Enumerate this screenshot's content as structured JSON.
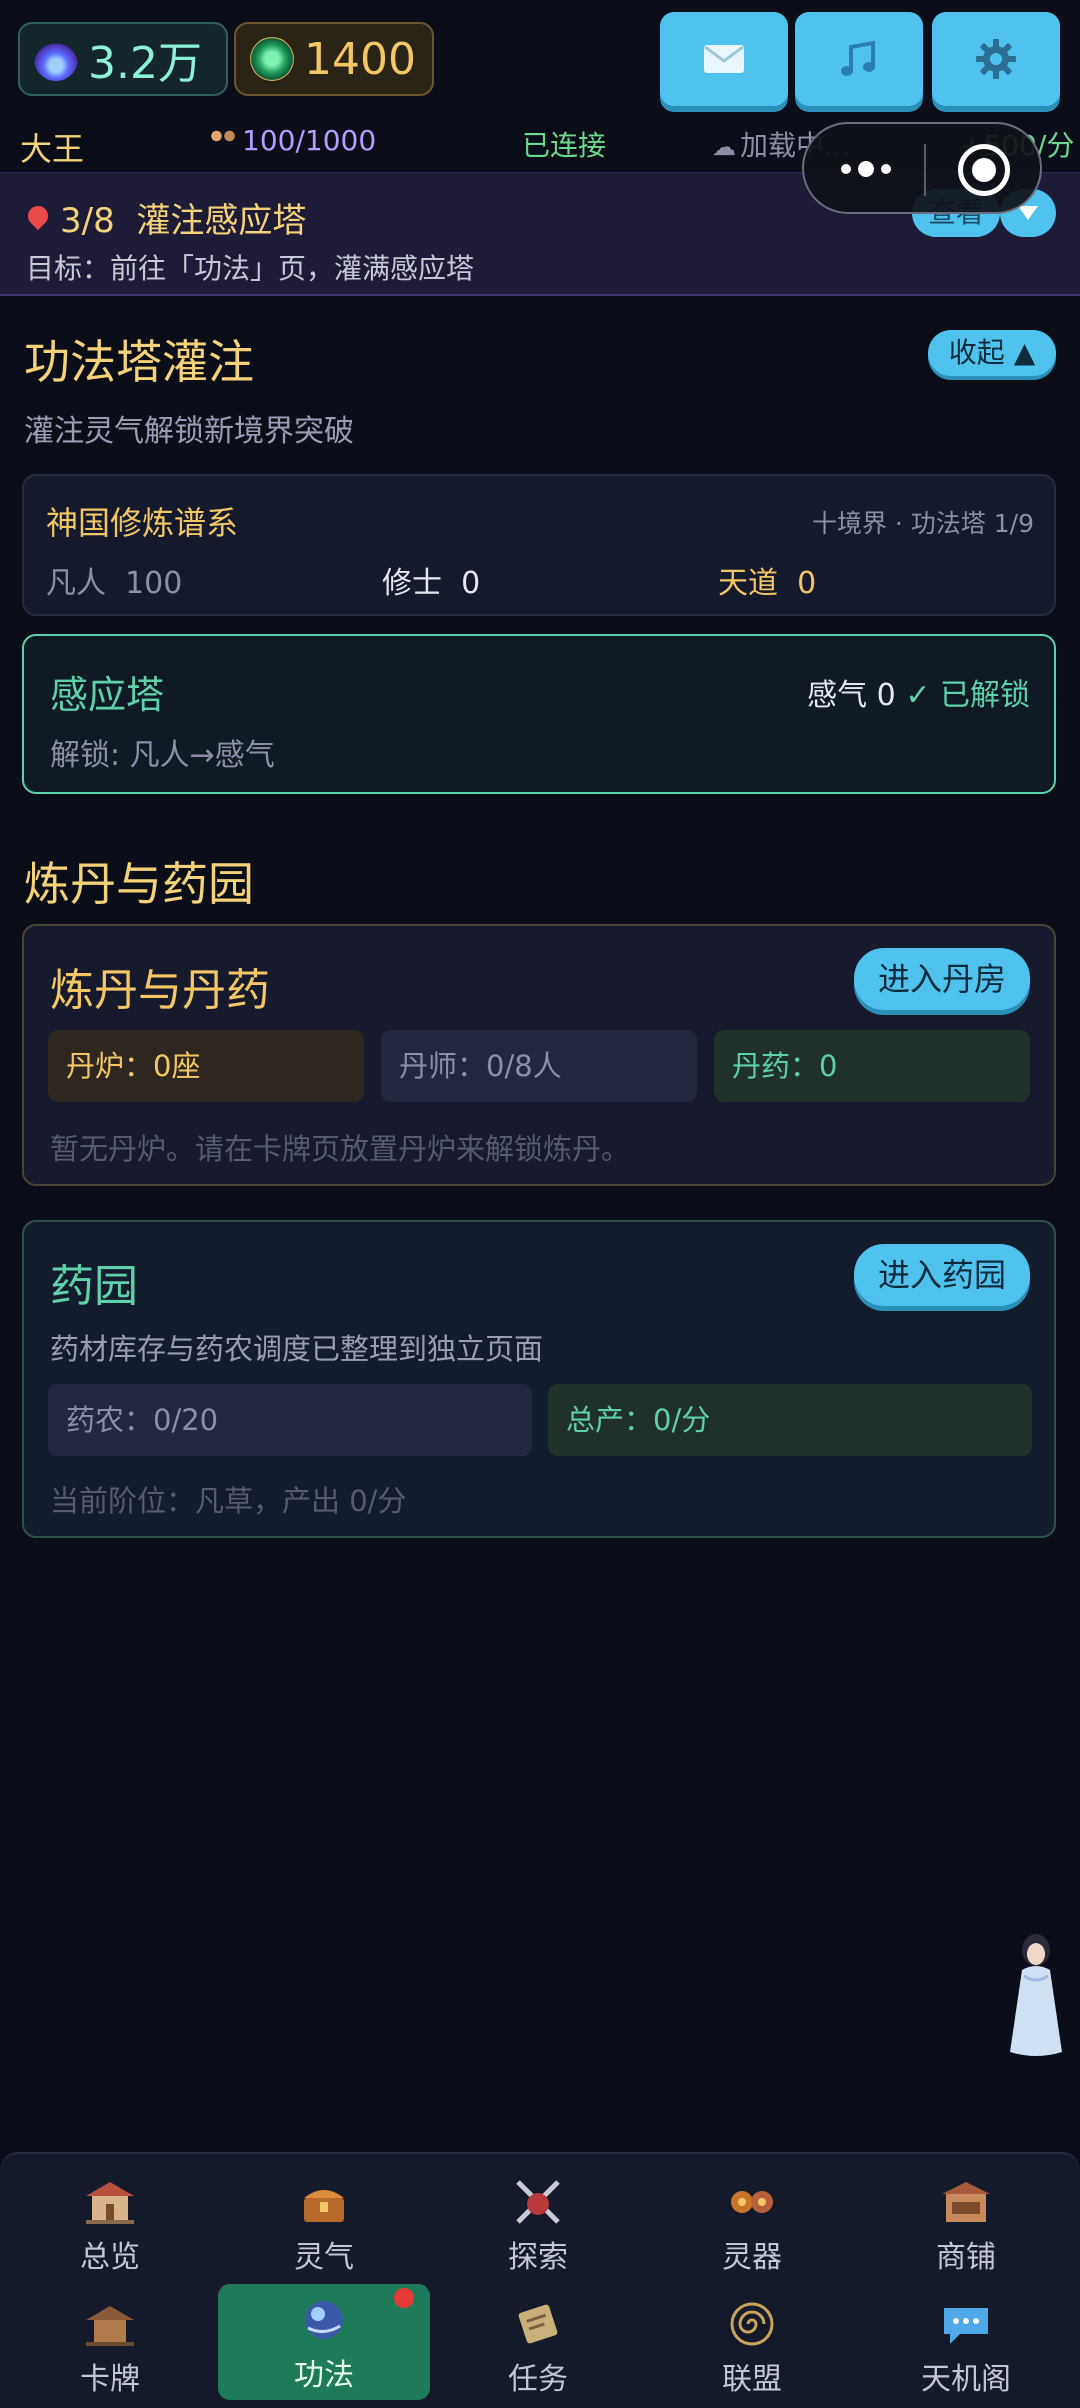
{
  "resources": {
    "spirit_value": "3.2万",
    "jade_value": "1400"
  },
  "status": {
    "player_name": "大王",
    "population": "100/1000",
    "connection": "已连接",
    "loading": "加载中...",
    "rate": "+500/分"
  },
  "quest": {
    "progress": "3/8",
    "title": "灌注感应塔",
    "goal": "目标：前往「功法」页，灌满感应塔",
    "view_label": "查看"
  },
  "tower_section": {
    "title": "功法塔灌注",
    "subtitle": "灌注灵气解锁新境界突破",
    "collapse_label": "收起",
    "lineage": {
      "title": "神国修炼谱系",
      "meta": "十境界 · 功法塔 1/9",
      "stats": [
        {
          "label": "凡人",
          "value": "100"
        },
        {
          "label": "修士",
          "value": "0"
        },
        {
          "label": "天道",
          "value": "0"
        }
      ]
    },
    "tower": {
      "name": "感应塔",
      "unlock": "解锁: 凡人→感气",
      "qi_label": "感气",
      "qi_value": "0",
      "status": "✓ 已解锁"
    }
  },
  "alchemy_section": {
    "title": "炼丹与药园",
    "alchemy": {
      "title": "炼丹与丹药",
      "enter_label": "进入丹房",
      "furnace": "丹炉：0座",
      "alchemist": "丹师：0/8人",
      "pills": "丹药：0",
      "note": "暂无丹炉。请在卡牌页放置丹炉来解锁炼丹。"
    },
    "herb": {
      "title": "药园",
      "enter_label": "进入药园",
      "desc": "药材库存与药农调度已整理到独立页面",
      "farmers": "药农：0/20",
      "output": "总产：0/分",
      "note": "当前阶位：凡草，产出 0/分"
    }
  },
  "nav": {
    "row1": [
      "总览",
      "灵气",
      "探索",
      "灵器",
      "商铺"
    ],
    "row2": [
      "卡牌",
      "功法",
      "任务",
      "联盟",
      "天机阁"
    ],
    "active": "功法"
  },
  "colors": {
    "accent": "#4fc3ee",
    "gold": "#f3d27a",
    "jade": "#5fd1a8",
    "active_tab": "#1f7a5a",
    "badge": "#e53935"
  }
}
